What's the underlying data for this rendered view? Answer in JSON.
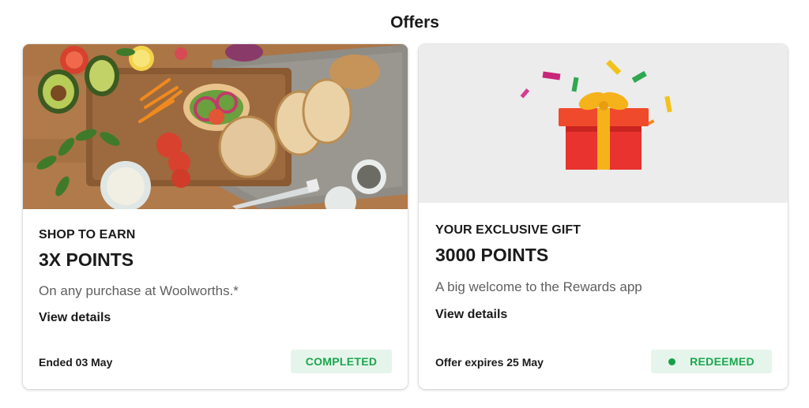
{
  "page": {
    "title": "Offers"
  },
  "offers": [
    {
      "eyebrow": "SHOP TO EARN",
      "headline": "3X POINTS",
      "description": "On any purchase at Woolworths.*",
      "details_label": "View details",
      "footer": "Ended 03 May",
      "status": "COMPLETED",
      "image": "sandwich-board-photo"
    },
    {
      "eyebrow": "YOUR EXCLUSIVE GIFT",
      "headline": "3000 POINTS",
      "description": "A big welcome to the Rewards app",
      "details_label": "View details",
      "footer": "Offer expires 25 May",
      "status": "REDEEMED",
      "image": "gift-box-icon"
    }
  ],
  "colors": {
    "status_text": "#1aa64d",
    "status_bg": "#e6f5ec",
    "gift_red": "#e8332e",
    "gift_ribbon": "#f5b21a"
  }
}
